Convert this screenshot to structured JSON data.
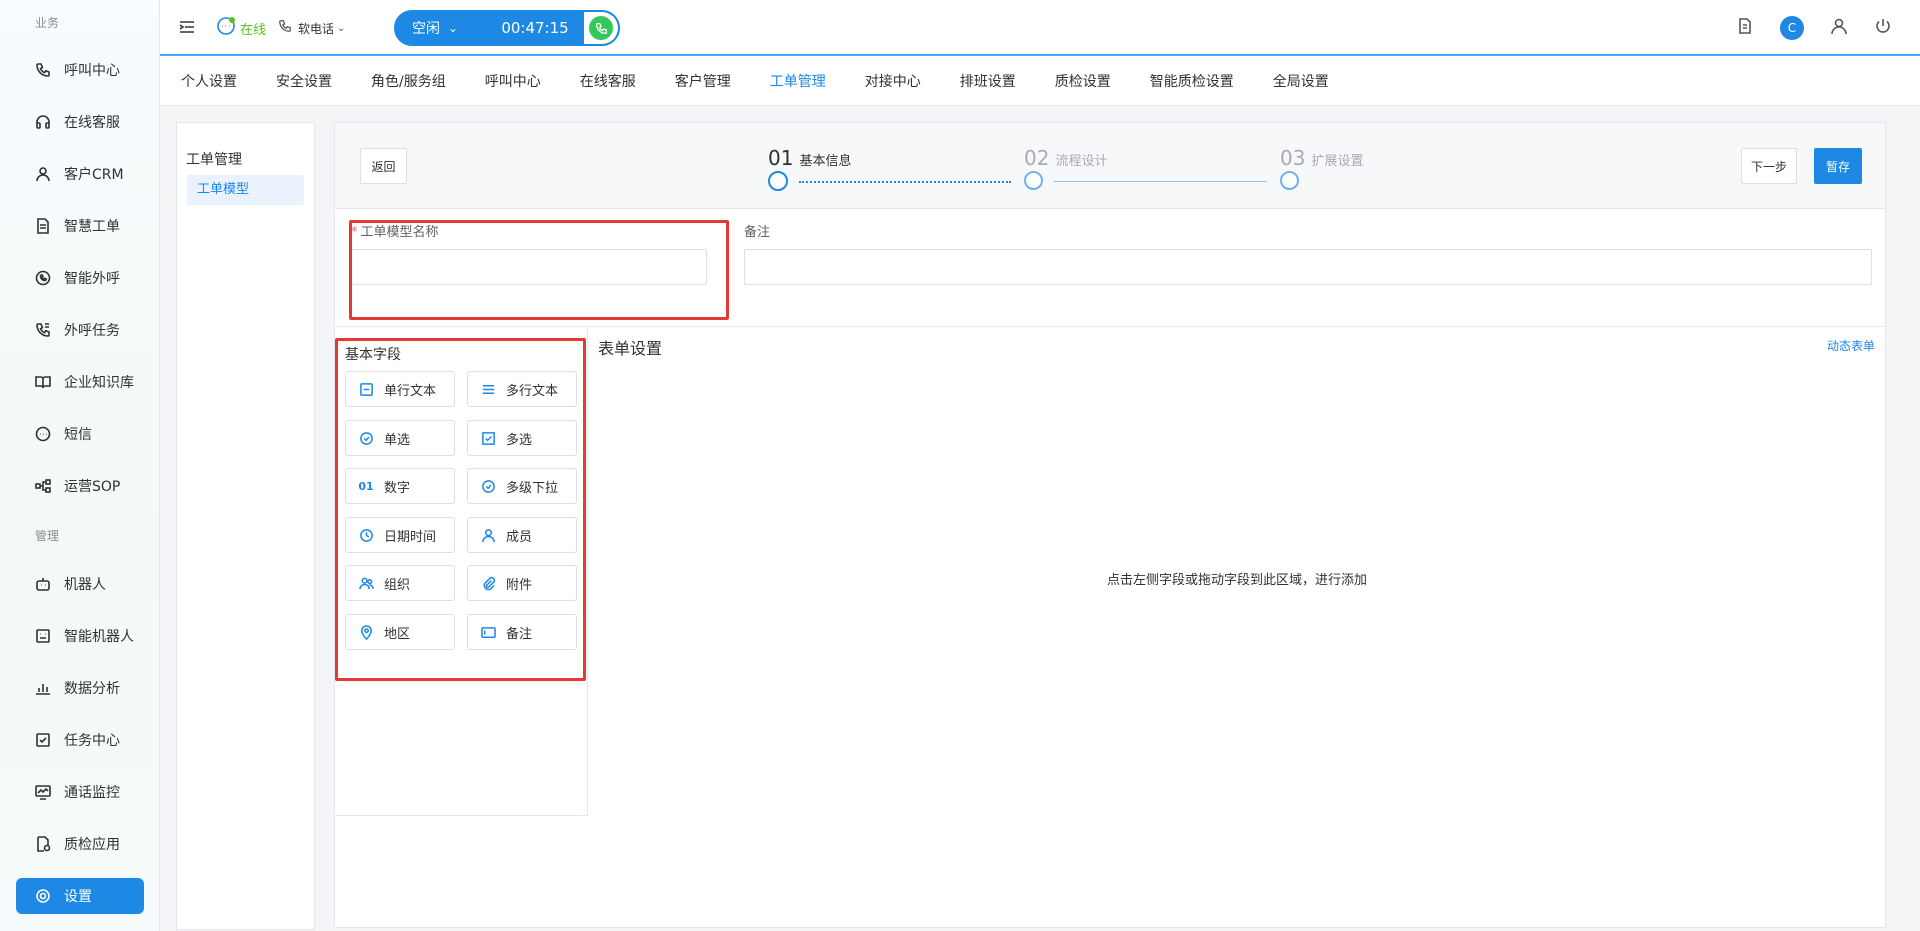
{
  "sidebar": {
    "section_business": "业务",
    "section_manage": "管理",
    "items": [
      {
        "label": "呼叫中心",
        "icon": "phone-icon"
      },
      {
        "label": "在线客服",
        "icon": "headset-icon"
      },
      {
        "label": "客户CRM",
        "icon": "user-icon"
      },
      {
        "label": "智慧工单",
        "icon": "document-icon"
      },
      {
        "label": "智能外呼",
        "icon": "whatsapp-icon"
      },
      {
        "label": "外呼任务",
        "icon": "phone-task-icon"
      },
      {
        "label": "企业知识库",
        "icon": "book-icon"
      },
      {
        "label": "短信",
        "icon": "sms-icon"
      },
      {
        "label": "运营SOP",
        "icon": "flow-icon"
      },
      {
        "label": "机器人",
        "icon": "robot-icon"
      },
      {
        "label": "智能机器人",
        "icon": "smart-robot-icon"
      },
      {
        "label": "数据分析",
        "icon": "chart-icon"
      },
      {
        "label": "任务中心",
        "icon": "task-icon"
      },
      {
        "label": "通话监控",
        "icon": "monitor-icon"
      },
      {
        "label": "质检应用",
        "icon": "inspect-icon"
      },
      {
        "label": "设置",
        "icon": "gear-icon"
      }
    ]
  },
  "header": {
    "status": "在线",
    "phone_type": "软电话",
    "call_state": "空闲",
    "timer": "00:47:15",
    "avatar_letter": "C"
  },
  "tabs": [
    "个人设置",
    "安全设置",
    "角色/服务组",
    "呼叫中心",
    "在线客服",
    "客户管理",
    "工单管理",
    "对接中心",
    "排班设置",
    "质检设置",
    "智能质检设置",
    "全局设置"
  ],
  "active_tab": "工单管理",
  "left_panel": {
    "title": "工单管理",
    "item": "工单模型"
  },
  "stepbar": {
    "back": "返回",
    "steps": [
      {
        "num": "01",
        "label": "基本信息"
      },
      {
        "num": "02",
        "label": "流程设计"
      },
      {
        "num": "03",
        "label": "扩展设置"
      }
    ],
    "next": "下一步",
    "save": "暂存"
  },
  "form": {
    "name_label": "工单模型名称",
    "remark_label": "备注",
    "name_value": "",
    "remark_value": ""
  },
  "fields": {
    "title": "基本字段",
    "items": [
      {
        "label": "单行文本",
        "icon": "single-line-icon"
      },
      {
        "label": "多行文本",
        "icon": "multi-line-icon"
      },
      {
        "label": "单选",
        "icon": "radio-icon"
      },
      {
        "label": "多选",
        "icon": "checkbox-icon"
      },
      {
        "label": "数字",
        "icon": "number-icon",
        "glyph": "01"
      },
      {
        "label": "多级下拉",
        "icon": "cascade-icon"
      },
      {
        "label": "日期时间",
        "icon": "clock-icon"
      },
      {
        "label": "成员",
        "icon": "member-icon"
      },
      {
        "label": "组织",
        "icon": "org-icon"
      },
      {
        "label": "附件",
        "icon": "attachment-icon"
      },
      {
        "label": "地区",
        "icon": "location-icon"
      },
      {
        "label": "备注",
        "icon": "remark-icon"
      }
    ]
  },
  "form_area": {
    "title": "表单设置",
    "dynamic_link": "动态表单",
    "empty_hint": "点击左侧字段或拖动字段到此区域，进行添加"
  },
  "colors": {
    "primary": "#1e88e5",
    "online": "#52c41a",
    "highlight": "#e53935"
  }
}
